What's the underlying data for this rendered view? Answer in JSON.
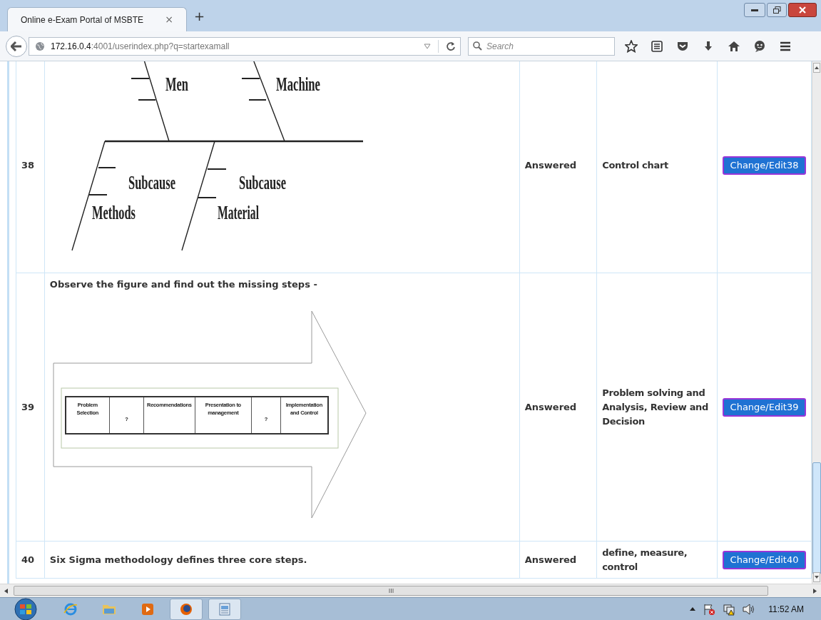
{
  "browser": {
    "tab_title": "Online e-Exam Portal of MSBTE",
    "tab_close": "×",
    "new_tab": "+",
    "url_host": "172.16.0.4",
    "url_rest": ":4001/userindex.php?q=startexamall",
    "search_placeholder": "Search"
  },
  "rows": [
    {
      "number": "38",
      "figure": {
        "kind": "fishbone",
        "labels": [
          "Men",
          "Machine",
          "Subcause",
          "Methods",
          "Subcause",
          "Material"
        ]
      },
      "status": "Answered",
      "answer": "Control chart",
      "button": "Change/Edit38"
    },
    {
      "number": "39",
      "question": "Observe the figure and find out the missing steps -",
      "figure": {
        "kind": "process_arrow",
        "steps": [
          "Problem Selection",
          "?",
          "Recommendations",
          "Presentation to management",
          "?",
          "Implementation and Control"
        ]
      },
      "status": "Answered",
      "answer": "Problem solving and Analysis, Review and Decision",
      "button": "Change/Edit39"
    },
    {
      "number": "40",
      "question": "Six Sigma methodology defines three core steps.",
      "status": "Answered",
      "answer": "define, measure, control",
      "button": "Change/Edit40"
    }
  ],
  "taskbar": {
    "time": "11:52 AM"
  }
}
